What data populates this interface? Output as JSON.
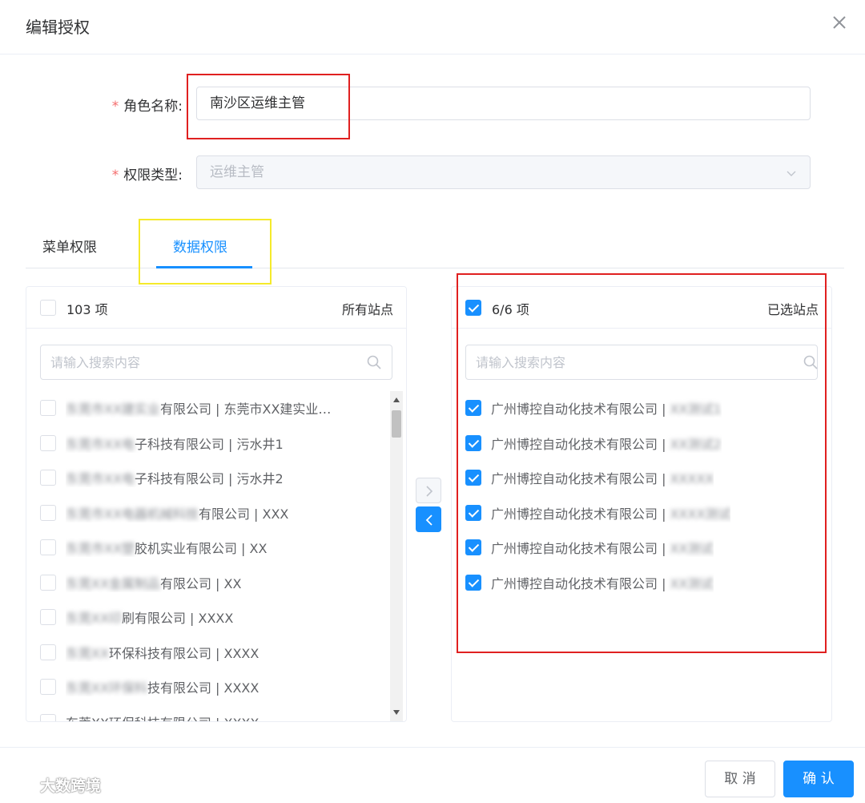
{
  "dialog": {
    "title": "编辑授权"
  },
  "form": {
    "role_name": {
      "required_mark": "*",
      "label": "角色名称:",
      "value": "南沙区运维主管"
    },
    "permission_type": {
      "required_mark": "*",
      "label": "权限类型:",
      "value": "运维主管"
    }
  },
  "tabs": [
    {
      "label": "菜单权限",
      "active": false
    },
    {
      "label": "数据权限",
      "active": true
    }
  ],
  "left_panel": {
    "count": "103 项",
    "title": "所有站点",
    "all_checked": false,
    "search_placeholder": "请输入搜索内容",
    "items": [
      {
        "blurred": "东莞市XX建实业",
        "text": "有限公司 | 东莞市XX建实业…",
        "checked": false
      },
      {
        "blurred": "东莞市XX电",
        "text": "子科技有限公司 | 污水井1",
        "checked": false
      },
      {
        "blurred": "东莞市XX电",
        "text": "子科技有限公司 | 污水井2",
        "checked": false
      },
      {
        "blurred": "东莞市XX电器机械科技",
        "text": "有限公司 | XXX",
        "checked": false
      },
      {
        "blurred": "东莞市XX塑",
        "text": "胶机实业有限公司 | XX",
        "checked": false
      },
      {
        "blurred": "东莞XX金属制品",
        "text": "有限公司 | XX",
        "checked": false
      },
      {
        "blurred": "东莞XX印",
        "text": "刷有限公司 | XXXX",
        "checked": false
      },
      {
        "blurred": "东莞XX",
        "text": "环保科技有限公司 | XXXX",
        "checked": false
      },
      {
        "blurred": "东莞XX环保科",
        "text": "技有限公司 | XXXX",
        "checked": false
      },
      {
        "blurred": "",
        "text": "东莞XX环保科技有限公司 | XXXX",
        "checked": false
      }
    ]
  },
  "right_panel": {
    "count": "6/6 项",
    "title": "已选站点",
    "all_checked": true,
    "search_placeholder": "请输入搜索内容",
    "items": [
      {
        "text": "广州博控自动化技术有限公司 |",
        "blurred": "XX测试1",
        "checked": true
      },
      {
        "text": "广州博控自动化技术有限公司 |",
        "blurred": "XX测试2",
        "checked": true
      },
      {
        "text": "广州博控自动化技术有限公司 |",
        "blurred": "XXXXX",
        "checked": true
      },
      {
        "text": "广州博控自动化技术有限公司 |",
        "blurred": "XXXX测试",
        "checked": true
      },
      {
        "text": "广州博控自动化技术有限公司 |",
        "blurred": "XX测试",
        "checked": true
      },
      {
        "text": "广州博控自动化技术有限公司 |",
        "blurred": "XX测试",
        "checked": true
      }
    ]
  },
  "transfer": {
    "to_right_icon": "chevron-right-icon",
    "to_left_icon": "chevron-left-icon"
  },
  "footer": {
    "cancel_label": "取 消",
    "ok_label": "确 认"
  },
  "watermark": {
    "text": "大数跨境"
  },
  "colors": {
    "primary": "#1890ff",
    "required": "#f56c6c",
    "annotation_red": "#e02020",
    "annotation_yellow": "#f5ea2b"
  }
}
